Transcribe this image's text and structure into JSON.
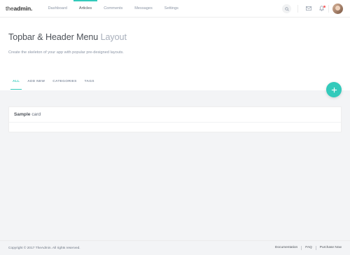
{
  "topbar": {
    "brand_prefix": "the",
    "brand_suffix": "admin.",
    "nav": [
      {
        "label": "Dashboard",
        "active": false
      },
      {
        "label": "Articles",
        "active": true
      },
      {
        "label": "Comments",
        "active": false
      },
      {
        "label": "Messages",
        "active": false
      },
      {
        "label": "Settings",
        "active": false
      }
    ],
    "icons": {
      "search": "search-icon",
      "messages": "envelope-icon",
      "notifications": "bell-icon",
      "avatar": "user-avatar"
    }
  },
  "header": {
    "title_main": "Topbar & Header Menu",
    "title_light": "Layout",
    "subtitle": "Create the skeleton of your app with popular pre-designed layouts.",
    "tabs": [
      {
        "label": "ALL",
        "active": true
      },
      {
        "label": "ADD NEW",
        "active": false
      },
      {
        "label": "CATEGORIES",
        "active": false
      },
      {
        "label": "TAGS",
        "active": false
      }
    ]
  },
  "fab": {
    "icon": "plus-icon"
  },
  "card": {
    "title_strong": "Sample",
    "title_light": "card"
  },
  "footer": {
    "copyright": "Copyright © 2017 TheAdmin. All rights reserved.",
    "links": [
      "Documentation",
      "FAQ",
      "Purchase Now"
    ]
  },
  "colors": {
    "accent": "#33cabb",
    "notification_dot": "#f96868",
    "background": "#f3f4f6",
    "text_primary": "#4d5259",
    "text_muted": "#8b95a5"
  }
}
